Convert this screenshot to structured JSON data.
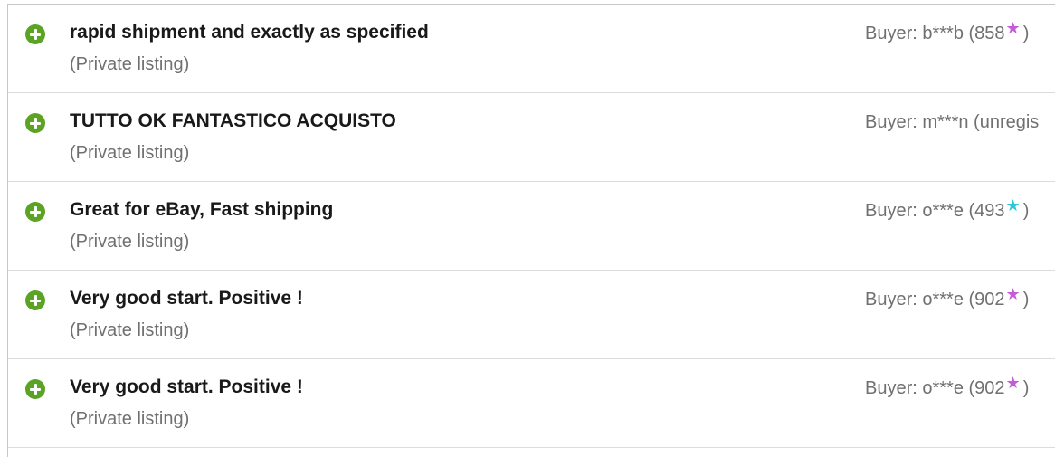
{
  "feedback": [
    {
      "comment": "rapid shipment and exactly as specified",
      "listing": "(Private listing)",
      "buyer_prefix": "Buyer: b***b (858",
      "star_color": "#c35cd6",
      "buyer_suffix": ")"
    },
    {
      "comment": "TUTTO OK FANTASTICO ACQUISTO",
      "listing": "(Private listing)",
      "buyer_prefix": "Buyer: m***n (unregis",
      "star_color": "",
      "buyer_suffix": ""
    },
    {
      "comment": "Great for eBay, Fast shipping",
      "listing": "(Private listing)",
      "buyer_prefix": "Buyer: o***e (493",
      "star_color": "#2bc8d9",
      "buyer_suffix": ")"
    },
    {
      "comment": "Very good start. Positive !",
      "listing": "(Private listing)",
      "buyer_prefix": "Buyer: o***e (902",
      "star_color": "#c35cd6",
      "buyer_suffix": ")"
    },
    {
      "comment": "Very good start. Positive !",
      "listing": "(Private listing)",
      "buyer_prefix": "Buyer: o***e (902",
      "star_color": "#c35cd6",
      "buyer_suffix": ")"
    }
  ],
  "icons": {
    "rating": "positive-feedback-icon",
    "star": "star-icon"
  },
  "colors": {
    "positive": "#5ba323"
  }
}
